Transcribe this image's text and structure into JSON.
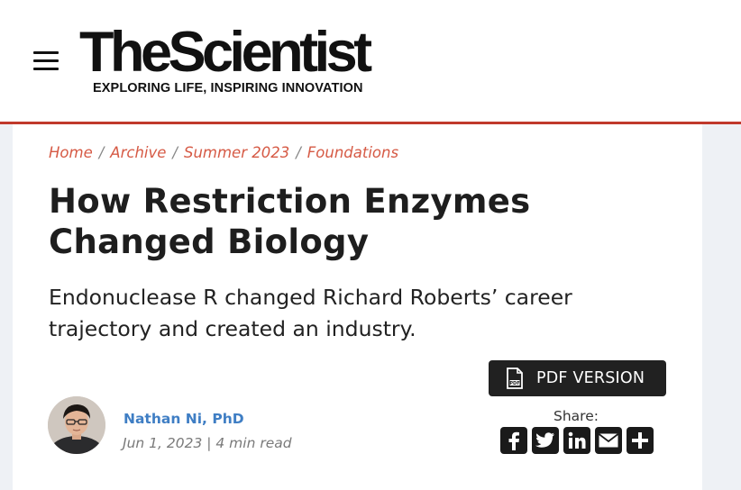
{
  "header": {
    "logo_text": "TheScientist",
    "tagline": "EXPLORING LIFE, INSPIRING INNOVATION",
    "menu_icon": "hamburger-menu-icon"
  },
  "breadcrumb": [
    "Home",
    "Archive",
    "Summer 2023",
    "Foundations"
  ],
  "article": {
    "title": "How Restriction Enzymes Changed Biology",
    "subtitle": "Endonuclease R changed Richard Roberts’ career trajectory and created an industry.",
    "pdf_button_label": "PDF VERSION",
    "author_name": "Nathan Ni, PhD",
    "meta": "Jun 1, 2023 | 4 min read"
  },
  "share": {
    "label": "Share:",
    "icons": [
      "facebook-icon",
      "twitter-icon",
      "linkedin-icon",
      "email-icon",
      "plus-icon"
    ]
  },
  "colors": {
    "accent_red": "#c0392b",
    "breadcrumb": "#d65a45",
    "author_link": "#3f7ec4",
    "button_dark": "#212121"
  }
}
